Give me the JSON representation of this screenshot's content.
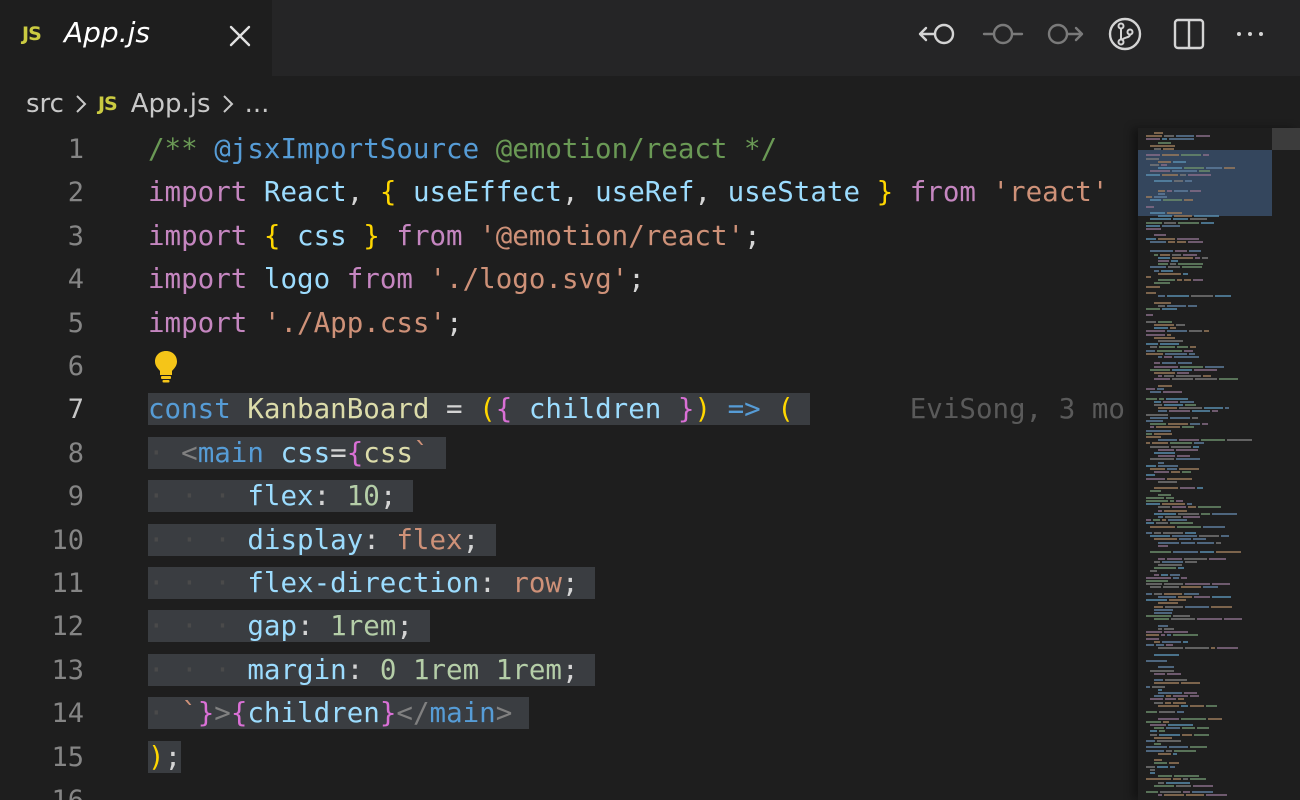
{
  "tab": {
    "badge": "JS",
    "title": "App.js"
  },
  "toolbar": {
    "icons": [
      "go-back-icon",
      "timeline-icon",
      "go-forward-icon",
      "source-control-icon",
      "split-editor-icon",
      "more-actions-icon"
    ]
  },
  "breadcrumb": {
    "folder": "src",
    "badge": "JS",
    "file": "App.js",
    "more": "..."
  },
  "editor": {
    "line_numbers": [
      "1",
      "2",
      "3",
      "4",
      "5",
      "6",
      "7",
      "8",
      "9",
      "10",
      "11",
      "12",
      "13",
      "14",
      "15",
      "16"
    ],
    "active_line": "7",
    "blame": "EviSong, 3 mo"
  },
  "code": {
    "l1": {
      "a": "/** ",
      "b": "@jsxImportSource",
      "c": " @emotion/react */"
    },
    "l2": {
      "kw1": "import",
      "sp": " ",
      "react": "React",
      "c1": ", ",
      "ob": "{",
      "s1": " ",
      "u1": "useEffect",
      "c2": ", ",
      "u2": "useRef",
      "c3": ", ",
      "u3": "useState",
      "s2": " ",
      "cb": "}",
      "s3": " ",
      "from": "from",
      "s4": " ",
      "str": "'react'"
    },
    "l3": {
      "kw": "import",
      "sp": " ",
      "ob": "{",
      "s1": " ",
      "css": "css",
      "s2": " ",
      "cb": "}",
      "s3": " ",
      "from": "from",
      "s4": " ",
      "str": "'@emotion/react'",
      "semi": ";"
    },
    "l4": {
      "kw": "import",
      "sp": " ",
      "logo": "logo",
      "s1": " ",
      "from": "from",
      "s2": " ",
      "str": "'./logo.svg'",
      "semi": ";"
    },
    "l5": {
      "kw": "import",
      "sp": " ",
      "str": "'./App.css'",
      "semi": ";"
    },
    "l7": {
      "const": "const",
      "s1": " ",
      "name": "KanbanBoard",
      "s2": " ",
      "eq": "=",
      "s3": " ",
      "p1": "(",
      "b1": "{",
      "s4": " ",
      "children": "children",
      "s5": " ",
      "b2": "}",
      "p2": ")",
      "s6": " ",
      "arrow": "=>",
      "s7": " ",
      "p3": "("
    },
    "l8": {
      "ws": "· ",
      "lt": "<",
      "tag": "main",
      "s1": " ",
      "attr": "css",
      "eq": "=",
      "ob": "{",
      "css": "css",
      "bt": "`"
    },
    "l9": {
      "ws": "· · · ",
      "prop": "flex",
      "colon": ": ",
      "val": "10",
      "semi": ";"
    },
    "l10": {
      "ws": "· · · ",
      "prop": "display",
      "colon": ": ",
      "val": "flex",
      "semi": ";"
    },
    "l11": {
      "ws": "· · · ",
      "prop": "flex-direction",
      "colon": ": ",
      "val": "row",
      "semi": ";"
    },
    "l12": {
      "ws": "· · · ",
      "prop": "gap",
      "colon": ": ",
      "val": "1rem",
      "semi": ";"
    },
    "l13": {
      "ws": "· · · ",
      "prop": "margin",
      "colon": ": ",
      "v1": "0",
      "s1": " ",
      "v2": "1rem",
      "s2": " ",
      "v3": "1rem",
      "semi": ";"
    },
    "l14": {
      "ws": "· ",
      "bt": "`",
      "cb": "}",
      "gt": ">",
      "ob": "{",
      "children": "children",
      "cb2": "}",
      "lt": "</",
      "tag": "main",
      "gt2": ">"
    },
    "l15": {
      "p": ")",
      "semi": ";"
    }
  },
  "colors": {
    "background": "#1e1e1e",
    "tabbar": "#252526",
    "selection": "#3a3d41",
    "js_badge": "#cbcb41"
  }
}
